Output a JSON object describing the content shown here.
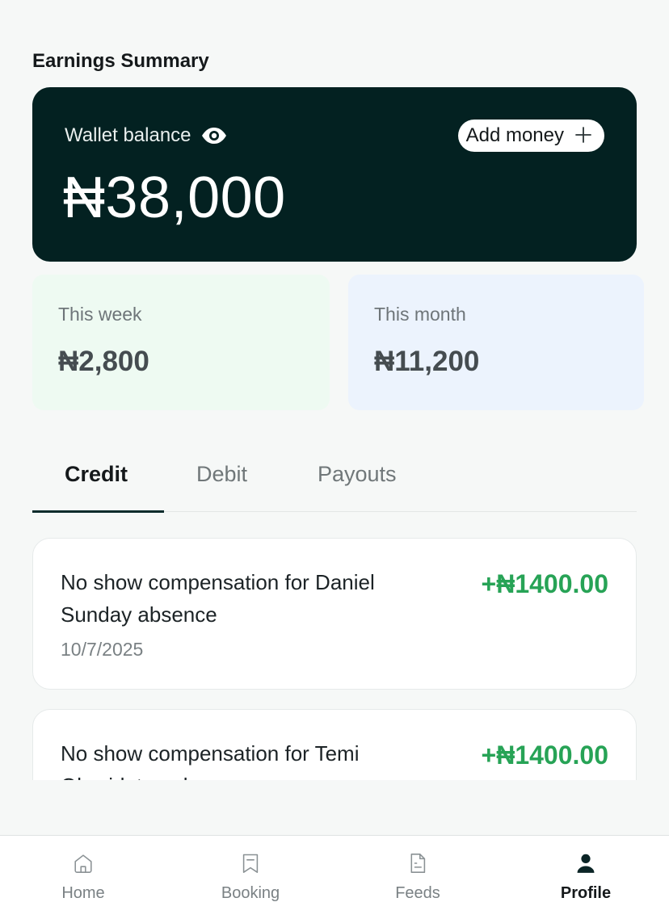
{
  "section_title": "Earnings Summary",
  "wallet": {
    "label": "Wallet balance",
    "amount": "₦38,000",
    "add_money_label": "Add money",
    "add_icon": "plus-icon",
    "visibility_icon": "eye-icon"
  },
  "stats": {
    "week": {
      "label": "This week",
      "value": "₦2,800"
    },
    "month": {
      "label": "This month",
      "value": "₦11,200"
    }
  },
  "tabs": [
    {
      "label": "Credit",
      "active": true
    },
    {
      "label": "Debit",
      "active": false
    },
    {
      "label": "Payouts",
      "active": false
    }
  ],
  "transactions": [
    {
      "description": "No show compensation for Daniel Sunday absence",
      "date": "10/7/2025",
      "amount": "+₦1400.00"
    },
    {
      "description": "No show compensation for Temi Oluwidotun absence",
      "date": "",
      "amount": "+₦1400.00"
    }
  ],
  "nav": [
    {
      "label": "Home",
      "icon": "home-icon",
      "active": false
    },
    {
      "label": "Booking",
      "icon": "bookmark-icon",
      "active": false
    },
    {
      "label": "Feeds",
      "icon": "document-icon",
      "active": false
    },
    {
      "label": "Profile",
      "icon": "user-icon",
      "active": true
    }
  ],
  "colors": {
    "wallet_bg": "#032121",
    "credit_green": "#27a356",
    "week_bg": "#eefaf2",
    "month_bg": "#ecf3fd"
  }
}
